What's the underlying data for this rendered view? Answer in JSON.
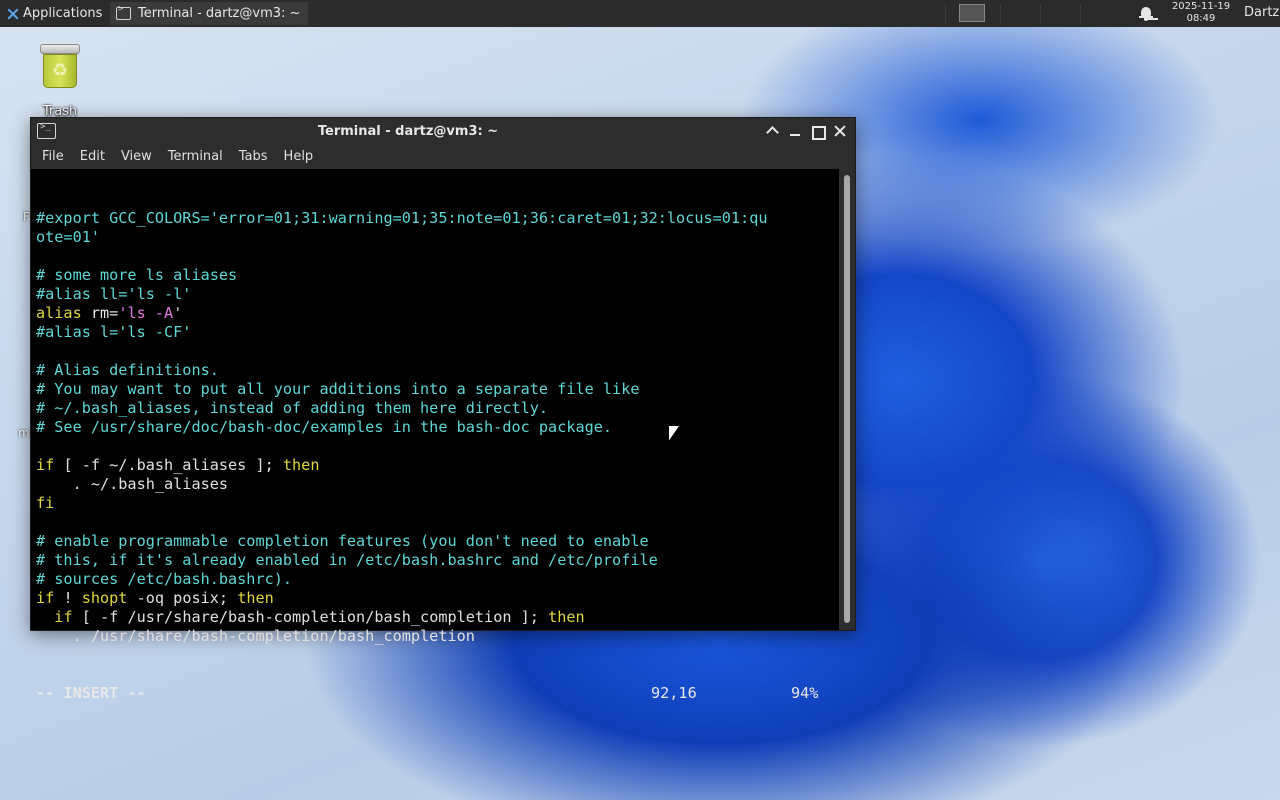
{
  "panel": {
    "applications_label": "Applications",
    "task_label": "Terminal - dartz@vm3: ~",
    "clock_date": "2025-11-19",
    "clock_time": "08:49",
    "user": "Dartz"
  },
  "desktop": {
    "trash_label": "Trash",
    "edge_char_1": "F",
    "edge_char_2": "m"
  },
  "window": {
    "title": "Terminal - dartz@vm3: ~",
    "menu": [
      "File",
      "Edit",
      "View",
      "Terminal",
      "Tabs",
      "Help"
    ]
  },
  "editor": {
    "lines": [
      [
        {
          "t": "#export GCC_COLORS='error=01;31:warning=01;35:note=01;36:caret=01;32:locus=01:qu",
          "c": "cmt"
        }
      ],
      [
        {
          "t": "ote=01'",
          "c": "cmt"
        }
      ],
      [],
      [
        {
          "t": "# some more ls aliases",
          "c": "cmt"
        }
      ],
      [
        {
          "t": "#alias ll='ls -l'",
          "c": "cmt"
        }
      ],
      [
        {
          "t": "alias ",
          "c": "kw"
        },
        {
          "t": "rm",
          "c": "id"
        },
        {
          "t": "=",
          "c": "plain"
        },
        {
          "t": "'ls -A",
          "c": "str"
        },
        {
          "t": "'",
          "c": "cursor"
        }
      ],
      [
        {
          "t": "#alias l='ls -CF'",
          "c": "cmt"
        }
      ],
      [],
      [
        {
          "t": "# Alias definitions.",
          "c": "cmt"
        }
      ],
      [
        {
          "t": "# You may want to put all your additions into a separate file like",
          "c": "cmt"
        }
      ],
      [
        {
          "t": "# ~/.bash_aliases, instead of adding them here directly.",
          "c": "cmt"
        }
      ],
      [
        {
          "t": "# See /usr/share/doc/bash-doc/examples in the bash-doc package.",
          "c": "cmt"
        }
      ],
      [],
      [
        {
          "t": "if",
          "c": "kw"
        },
        {
          "t": " [ -f ~/.bash_aliases ]; ",
          "c": "plain"
        },
        {
          "t": "then",
          "c": "kw"
        }
      ],
      [
        {
          "t": "    . ~/.bash_aliases",
          "c": "plain"
        }
      ],
      [
        {
          "t": "fi",
          "c": "kw"
        }
      ],
      [],
      [
        {
          "t": "# enable programmable completion features (you don't need to enable",
          "c": "cmt"
        }
      ],
      [
        {
          "t": "# this, if it's already enabled in /etc/bash.bashrc and /etc/profile",
          "c": "cmt"
        }
      ],
      [
        {
          "t": "# sources /etc/bash.bashrc).",
          "c": "cmt"
        }
      ],
      [
        {
          "t": "if",
          "c": "kw"
        },
        {
          "t": " ! ",
          "c": "plain"
        },
        {
          "t": "shopt",
          "c": "kw"
        },
        {
          "t": " -oq posix; ",
          "c": "plain"
        },
        {
          "t": "then",
          "c": "kw"
        }
      ],
      [
        {
          "t": "  ",
          "c": "plain"
        },
        {
          "t": "if",
          "c": "kw"
        },
        {
          "t": " [ -f /usr/share/bash-completion/bash_completion ]; ",
          "c": "plain"
        },
        {
          "t": "then",
          "c": "kw"
        }
      ],
      [
        {
          "t": "    . /usr/share/bash-completion/bash_completion",
          "c": "plain"
        }
      ]
    ],
    "status_mode": "-- INSERT --",
    "status_position": "92,16",
    "status_percent": "94%"
  },
  "colors": {
    "comment": "#5fd7d7",
    "keyword": "#e0d740",
    "string": "#e07ae0",
    "cursor": "#e5e500"
  }
}
